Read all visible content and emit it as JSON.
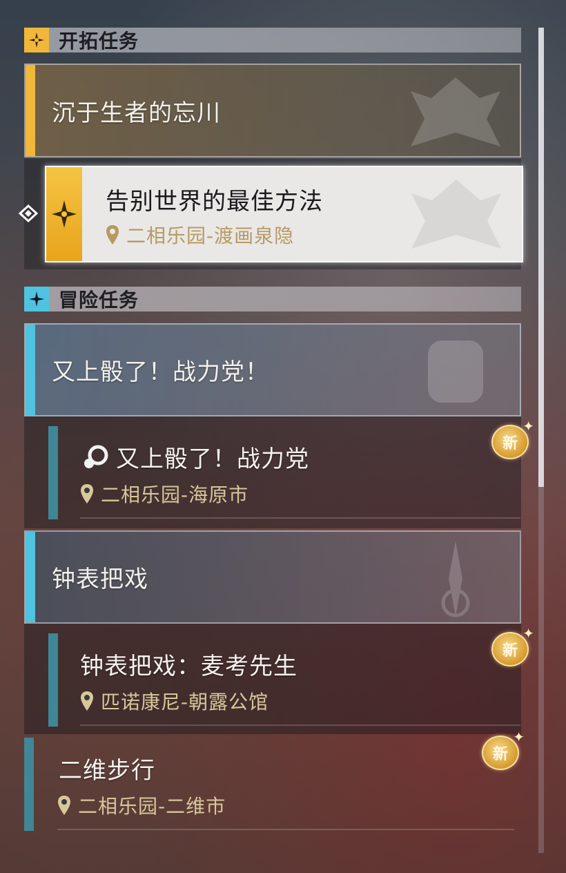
{
  "sections": {
    "trailblaze": {
      "title": "开拓任务",
      "icon": "trailblaze-star-icon",
      "color": "#f0b73a"
    },
    "adventure": {
      "title": "冒险任务",
      "icon": "adventure-star-icon",
      "color": "#4fc3e0"
    }
  },
  "trailblaze_mission": {
    "title": "沉于生者的忘川",
    "sub": {
      "title": "告别世界的最佳方法",
      "location": "二相乐园-渡画泉隐"
    }
  },
  "adventure_missions": [
    {
      "title": "又上骰了！战力党！",
      "sub": {
        "title": "又上骰了！战力党",
        "location": "二相乐园-海原市",
        "badge": "新"
      }
    },
    {
      "title": "钟表把戏",
      "sub": {
        "title": "钟表把戏：麦考先生",
        "location": "匹诺康尼-朝露公馆",
        "badge": "新"
      }
    }
  ],
  "standalone": {
    "title": "二维步行",
    "location": "二相乐园-二维市",
    "badge": "新"
  }
}
